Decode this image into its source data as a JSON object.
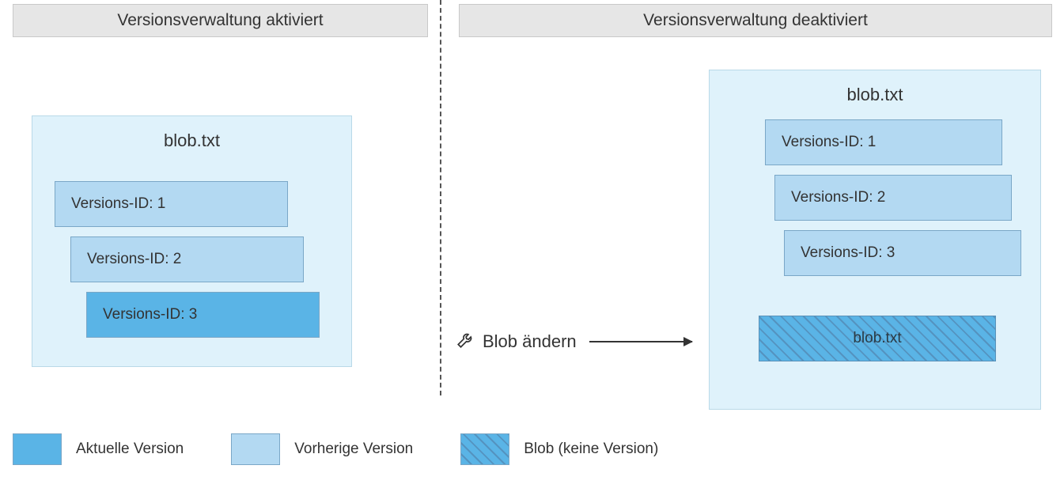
{
  "headers": {
    "left": "Versionsverwaltung aktiviert",
    "right": "Versionsverwaltung deaktiviert"
  },
  "left_panel": {
    "blob_title": "blob.txt",
    "versions": [
      {
        "label": "Versions-ID: 1",
        "state": "previous"
      },
      {
        "label": "Versions-ID: 2",
        "state": "previous"
      },
      {
        "label": "Versions-ID: 3",
        "state": "current"
      }
    ]
  },
  "right_panel": {
    "blob_title": "blob.txt",
    "versions": [
      {
        "label": "Versions-ID: 1",
        "state": "previous"
      },
      {
        "label": "Versions-ID: 2",
        "state": "previous"
      },
      {
        "label": "Versions-ID: 3",
        "state": "previous"
      }
    ],
    "unversioned_blob_label": "blob.txt"
  },
  "action_label": "Blob ändern",
  "legend": {
    "current": "Aktuelle Version",
    "previous": "Vorherige Version",
    "unversioned": "Blob (keine Version)"
  },
  "colors": {
    "header_bg": "#e6e6e6",
    "container_bg": "#dff2fb",
    "previous_version": "#b3d9f2",
    "current_version": "#5ab4e6"
  }
}
